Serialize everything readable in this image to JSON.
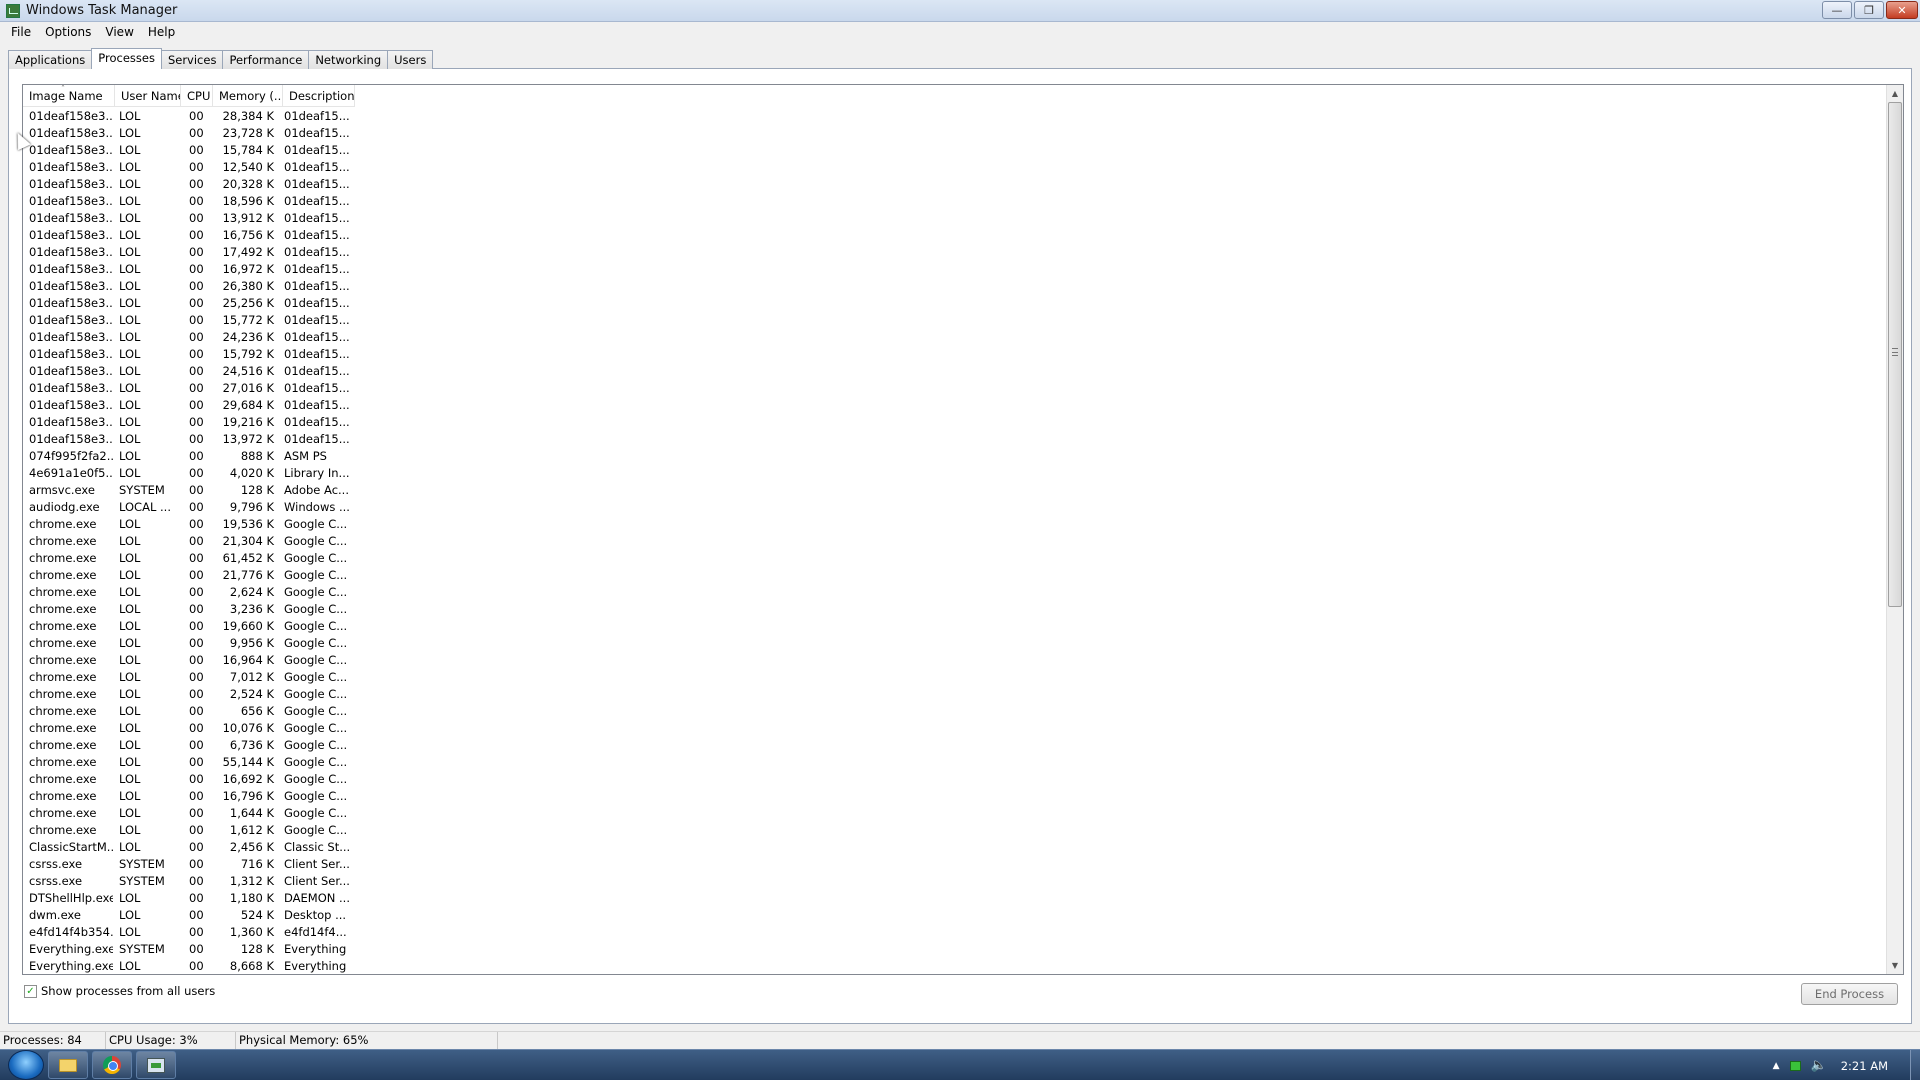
{
  "window": {
    "title": "Windows Task Manager",
    "controls": {
      "minimize": "—",
      "maximize": "❐",
      "close": "✕"
    }
  },
  "menu": [
    "File",
    "Options",
    "View",
    "Help"
  ],
  "tabs": [
    "Applications",
    "Processes",
    "Services",
    "Performance",
    "Networking",
    "Users"
  ],
  "active_tab": "Processes",
  "columns": [
    "Image Name",
    "User Name",
    "CPU",
    "Memory (...",
    "Description"
  ],
  "sort_indicator": "˄",
  "rows": [
    [
      "01deaf158e3...",
      "LOL",
      "00",
      "28,384 K",
      "01deaf15..."
    ],
    [
      "01deaf158e3...",
      "LOL",
      "00",
      "23,728 K",
      "01deaf15..."
    ],
    [
      "01deaf158e3...",
      "LOL",
      "00",
      "15,784 K",
      "01deaf15..."
    ],
    [
      "01deaf158e3...",
      "LOL",
      "00",
      "12,540 K",
      "01deaf15..."
    ],
    [
      "01deaf158e3...",
      "LOL",
      "00",
      "20,328 K",
      "01deaf15..."
    ],
    [
      "01deaf158e3...",
      "LOL",
      "00",
      "18,596 K",
      "01deaf15..."
    ],
    [
      "01deaf158e3...",
      "LOL",
      "00",
      "13,912 K",
      "01deaf15..."
    ],
    [
      "01deaf158e3...",
      "LOL",
      "00",
      "16,756 K",
      "01deaf15..."
    ],
    [
      "01deaf158e3...",
      "LOL",
      "00",
      "17,492 K",
      "01deaf15..."
    ],
    [
      "01deaf158e3...",
      "LOL",
      "00",
      "16,972 K",
      "01deaf15..."
    ],
    [
      "01deaf158e3...",
      "LOL",
      "00",
      "26,380 K",
      "01deaf15..."
    ],
    [
      "01deaf158e3...",
      "LOL",
      "00",
      "25,256 K",
      "01deaf15..."
    ],
    [
      "01deaf158e3...",
      "LOL",
      "00",
      "15,772 K",
      "01deaf15..."
    ],
    [
      "01deaf158e3...",
      "LOL",
      "00",
      "24,236 K",
      "01deaf15..."
    ],
    [
      "01deaf158e3...",
      "LOL",
      "00",
      "15,792 K",
      "01deaf15..."
    ],
    [
      "01deaf158e3...",
      "LOL",
      "00",
      "24,516 K",
      "01deaf15..."
    ],
    [
      "01deaf158e3...",
      "LOL",
      "00",
      "27,016 K",
      "01deaf15..."
    ],
    [
      "01deaf158e3...",
      "LOL",
      "00",
      "29,684 K",
      "01deaf15..."
    ],
    [
      "01deaf158e3...",
      "LOL",
      "00",
      "19,216 K",
      "01deaf15..."
    ],
    [
      "01deaf158e3...",
      "LOL",
      "00",
      "13,972 K",
      "01deaf15..."
    ],
    [
      "074f995f2fa2...",
      "LOL",
      "00",
      "888 K",
      "ASM PS"
    ],
    [
      "4e691a1e0f5...",
      "LOL",
      "00",
      "4,020 K",
      "Library In..."
    ],
    [
      "armsvc.exe",
      "SYSTEM",
      "00",
      "128 K",
      "Adobe Ac..."
    ],
    [
      "audiodg.exe",
      "LOCAL ...",
      "00",
      "9,796 K",
      "Windows ..."
    ],
    [
      "chrome.exe",
      "LOL",
      "00",
      "19,536 K",
      "Google C..."
    ],
    [
      "chrome.exe",
      "LOL",
      "00",
      "21,304 K",
      "Google C..."
    ],
    [
      "chrome.exe",
      "LOL",
      "00",
      "61,452 K",
      "Google C..."
    ],
    [
      "chrome.exe",
      "LOL",
      "00",
      "21,776 K",
      "Google C..."
    ],
    [
      "chrome.exe",
      "LOL",
      "00",
      "2,624 K",
      "Google C..."
    ],
    [
      "chrome.exe",
      "LOL",
      "00",
      "3,236 K",
      "Google C..."
    ],
    [
      "chrome.exe",
      "LOL",
      "00",
      "19,660 K",
      "Google C..."
    ],
    [
      "chrome.exe",
      "LOL",
      "00",
      "9,956 K",
      "Google C..."
    ],
    [
      "chrome.exe",
      "LOL",
      "00",
      "16,964 K",
      "Google C..."
    ],
    [
      "chrome.exe",
      "LOL",
      "00",
      "7,012 K",
      "Google C..."
    ],
    [
      "chrome.exe",
      "LOL",
      "00",
      "2,524 K",
      "Google C..."
    ],
    [
      "chrome.exe",
      "LOL",
      "00",
      "656 K",
      "Google C..."
    ],
    [
      "chrome.exe",
      "LOL",
      "00",
      "10,076 K",
      "Google C..."
    ],
    [
      "chrome.exe",
      "LOL",
      "00",
      "6,736 K",
      "Google C..."
    ],
    [
      "chrome.exe",
      "LOL",
      "00",
      "55,144 K",
      "Google C..."
    ],
    [
      "chrome.exe",
      "LOL",
      "00",
      "16,692 K",
      "Google C..."
    ],
    [
      "chrome.exe",
      "LOL",
      "00",
      "16,796 K",
      "Google C..."
    ],
    [
      "chrome.exe",
      "LOL",
      "00",
      "1,644 K",
      "Google C..."
    ],
    [
      "chrome.exe",
      "LOL",
      "00",
      "1,612 K",
      "Google C..."
    ],
    [
      "ClassicStartM...",
      "LOL",
      "00",
      "2,456 K",
      "Classic St..."
    ],
    [
      "csrss.exe",
      "SYSTEM",
      "00",
      "716 K",
      "Client Ser..."
    ],
    [
      "csrss.exe",
      "SYSTEM",
      "00",
      "1,312 K",
      "Client Ser..."
    ],
    [
      "DTShellHlp.exe",
      "LOL",
      "00",
      "1,180 K",
      "DAEMON ..."
    ],
    [
      "dwm.exe",
      "LOL",
      "00",
      "524 K",
      "Desktop ..."
    ],
    [
      "e4fd14f4b354...",
      "LOL",
      "00",
      "1,360 K",
      "e4fd14f4..."
    ],
    [
      "Everything.exe",
      "SYSTEM",
      "00",
      "128 K",
      "Everything"
    ],
    [
      "Everything.exe",
      "LOL",
      "00",
      "8,668 K",
      "Everything"
    ]
  ],
  "scrollbar": {
    "up": "▲",
    "down": "▼",
    "position": 0.0
  },
  "show_all_users": {
    "label": "Show processes from all users",
    "checked": true,
    "mark": "✓"
  },
  "end_process_label": "End Process",
  "status": {
    "processes": "Processes: 84",
    "cpu": "CPU Usage: 3%",
    "memory": "Physical Memory: 65%"
  },
  "taskbar": {
    "apps": [
      "folder-icon",
      "chrome-icon",
      "task-manager-icon"
    ],
    "tray_up": "▲",
    "volume": "🔈",
    "clock": "2:21 AM"
  }
}
